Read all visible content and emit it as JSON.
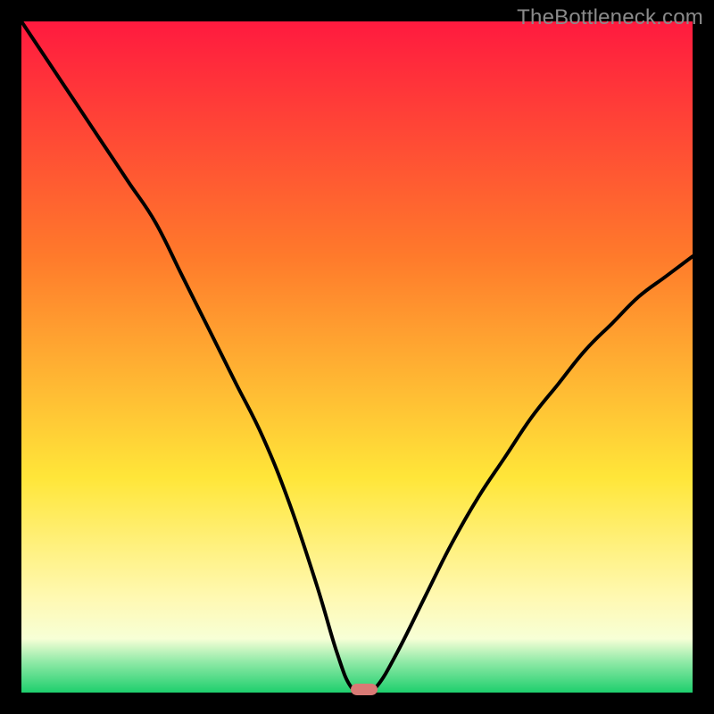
{
  "watermark": {
    "text": "TheBottleneck.com"
  },
  "colors": {
    "bg_black": "#000000",
    "grad_top": "#ff1a3f",
    "grad_mid1": "#ff7a2b",
    "grad_mid2": "#ffe639",
    "grad_paleyellow": "#fff9b3",
    "grad_palegreen": "#8ee9a6",
    "grad_green": "#1ecf6d",
    "curve": "#000000",
    "oval": "#d97a75"
  },
  "plot": {
    "x_range": [
      0,
      100
    ],
    "y_range": [
      0,
      100
    ]
  },
  "chart_data": {
    "type": "line",
    "title": "",
    "xlabel": "",
    "ylabel": "",
    "xlim": [
      0,
      100
    ],
    "ylim": [
      0,
      100
    ],
    "series": [
      {
        "name": "curve",
        "x": [
          0,
          4,
          8,
          12,
          16,
          20,
          24,
          28,
          32,
          36,
          40,
          44,
          47,
          49,
          51,
          53,
          56,
          60,
          64,
          68,
          72,
          76,
          80,
          84,
          88,
          92,
          96,
          100
        ],
        "y": [
          100,
          94,
          88,
          82,
          76,
          70,
          62,
          54,
          46,
          38,
          28,
          16,
          6,
          1,
          0,
          1,
          6,
          14,
          22,
          29,
          35,
          41,
          46,
          51,
          55,
          59,
          62,
          65
        ]
      }
    ],
    "marker": {
      "x": 51,
      "y": 0.5,
      "shape": "oval",
      "color": "#d97a75"
    },
    "background_gradient": {
      "stops": [
        {
          "pos": 0.0,
          "color": "#ff1a3f"
        },
        {
          "pos": 0.35,
          "color": "#ff7a2b"
        },
        {
          "pos": 0.68,
          "color": "#ffe639"
        },
        {
          "pos": 0.86,
          "color": "#fff9b3"
        },
        {
          "pos": 0.92,
          "color": "#f7ffd6"
        },
        {
          "pos": 0.955,
          "color": "#8ee9a6"
        },
        {
          "pos": 1.0,
          "color": "#1ecf6d"
        }
      ]
    }
  }
}
